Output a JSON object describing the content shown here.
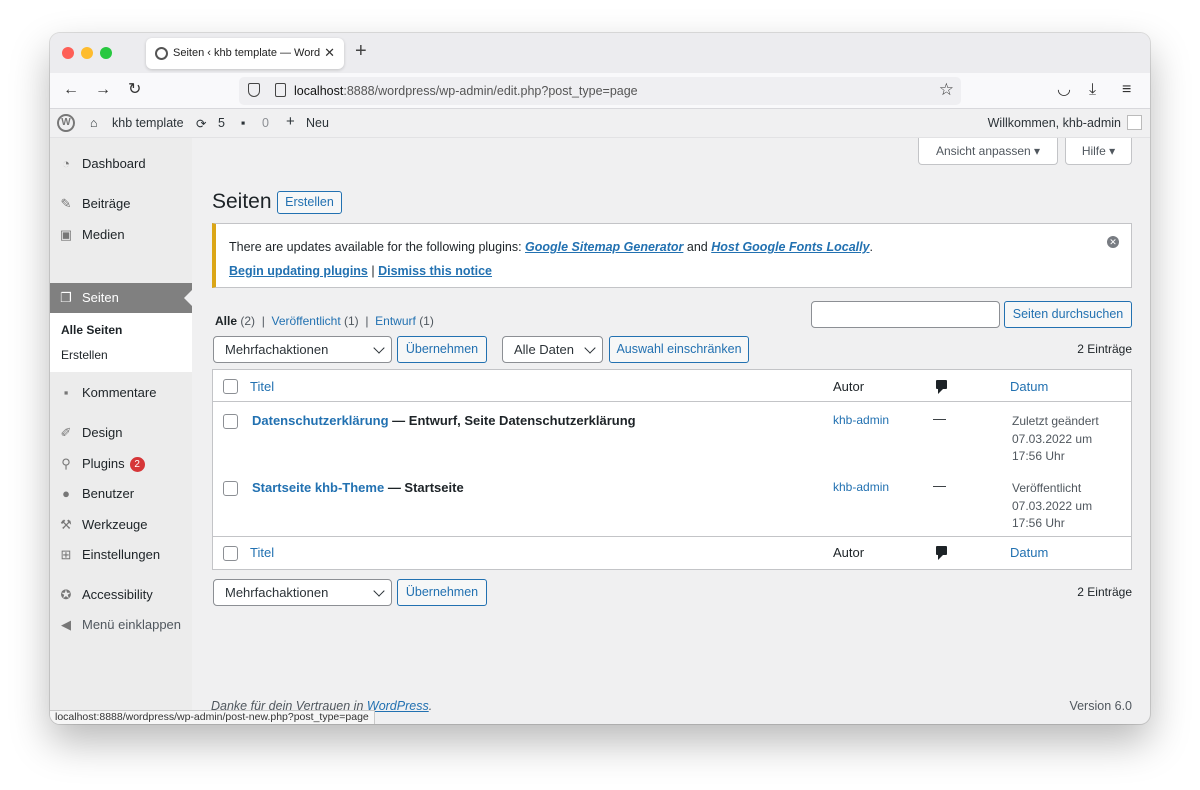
{
  "browser": {
    "tab_title": "Seiten ‹ khb template — WordPress",
    "tab_close": "✕",
    "new_tab": "+",
    "url_host": "localhost",
    "url_rest": ":8888/wordpress/wp-admin/edit.php?post_type=page",
    "status_url": "localhost:8888/wordpress/wp-admin/post-new.php?post_type=page"
  },
  "adminbar": {
    "site_name": "khb template",
    "updates_count": "5",
    "comments_count": "0",
    "new_label": "Neu",
    "greeting": "Willkommen, khb-admin"
  },
  "sidebar": {
    "items": [
      {
        "label": "Dashboard",
        "icon": "dashboard-icon"
      },
      {
        "label": "Beiträge",
        "icon": "pin-icon"
      },
      {
        "label": "Medien",
        "icon": "media-icon"
      },
      {
        "label": "Seiten",
        "icon": "pages-icon"
      },
      {
        "label": "Kommentare",
        "icon": "comment-icon"
      },
      {
        "label": "Design",
        "icon": "brush-icon"
      },
      {
        "label": "Plugins",
        "icon": "plugin-icon",
        "badge": "2"
      },
      {
        "label": "Benutzer",
        "icon": "user-icon"
      },
      {
        "label": "Werkzeuge",
        "icon": "wrench-icon"
      },
      {
        "label": "Einstellungen",
        "icon": "settings-icon"
      },
      {
        "label": "Accessibility",
        "icon": "accessibility-icon"
      },
      {
        "label": "Menü einklappen",
        "icon": "collapse-icon"
      }
    ],
    "submenu": [
      "Alle Seiten",
      "Erstellen"
    ]
  },
  "header": {
    "title": "Seiten",
    "create_button": "Erstellen",
    "screen_options": "Ansicht anpassen",
    "help": "Hilfe"
  },
  "notice": {
    "text_before": "There are updates available for the following plugins: ",
    "plugin1": "Google Sitemap Generator",
    "and": " and ",
    "plugin2": "Host Google Fonts Locally",
    "period": ".",
    "begin_link": "Begin updating plugins",
    "separator": " | ",
    "dismiss_link": "Dismiss this notice"
  },
  "filters": {
    "all": "Alle",
    "all_count": "(2)",
    "published": "Veröffentlicht",
    "published_count": "(1)",
    "draft": "Entwurf",
    "draft_count": "(1)",
    "sep": "|"
  },
  "search": {
    "button": "Seiten durchsuchen",
    "value": ""
  },
  "bulk": {
    "select_value": "Mehrfachaktionen",
    "apply": "Übernehmen",
    "date_select": "Alle Daten",
    "filter_button": "Auswahl einschränken",
    "count": "2 Einträge"
  },
  "table": {
    "columns": {
      "title": "Titel",
      "author": "Autor",
      "date": "Datum"
    },
    "rows": [
      {
        "title": "Datenschutzerklärung",
        "state": " — Entwurf, Seite Datenschutzerklärung",
        "author": "khb-admin",
        "comments": "—",
        "date_status": "Zuletzt geändert",
        "date_day": "07.03.2022 um",
        "date_time": "17:56 Uhr"
      },
      {
        "title": "Startseite khb-Theme",
        "state": " — Startseite",
        "author": "khb-admin",
        "comments": "—",
        "date_status": "Veröffentlicht",
        "date_day": "07.03.2022 um",
        "date_time": "17:56 Uhr"
      }
    ]
  },
  "footer": {
    "thanks_before": "Danke für dein Vertrauen in ",
    "thanks_link": "WordPress",
    "thanks_after": ".",
    "version": "Version 6.0"
  }
}
